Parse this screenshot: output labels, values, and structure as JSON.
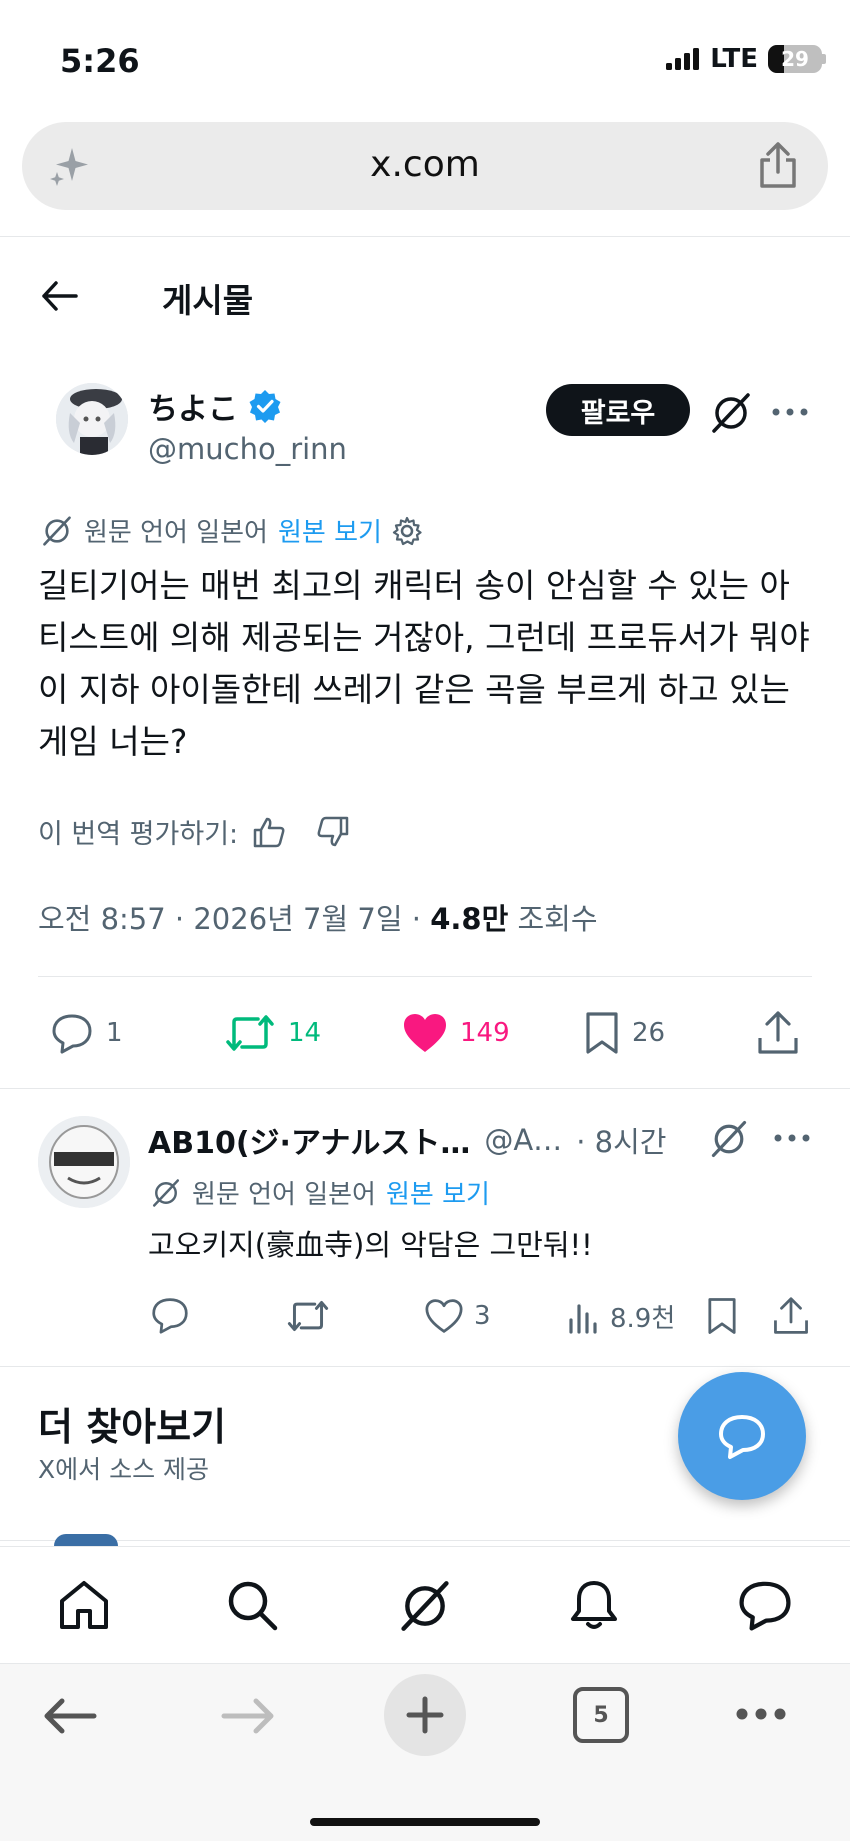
{
  "status_bar": {
    "time": "5:26",
    "network": "LTE",
    "battery": "29",
    "battery_level": 0.29
  },
  "browser": {
    "url": "x.com",
    "tab_count": "5"
  },
  "header": {
    "title": "게시물"
  },
  "tweet": {
    "name": "ちよこ",
    "handle": "@mucho_rinn",
    "follow_label": "팔로우",
    "translated_from": "원문 언어 일본어",
    "view_original": "원본 보기",
    "text": "길티기어는 매번 최고의 캐릭터 송이 안심할 수 있는 아티스트에 의해 제공되는 거잖아, 그런데 프로듀서가 뭐야 이 지하 아이돌한테 쓰레기 같은 곡을 부르게 하고 있는 게임 너는?",
    "rate_translation": "이 번역 평가하기:",
    "time": "오전 8:57",
    "date": "2026년 7월 7일",
    "views_count": "4.8만",
    "views_label": "조회수",
    "replies": "1",
    "reposts": "14",
    "likes": "149",
    "bookmarks": "26"
  },
  "reply": {
    "name": "AB10(ジ·アナルスト…",
    "handle": "@A…",
    "time": "· 8시간",
    "translated_from": "원문 언어 일본어",
    "view_original": "원본 보기",
    "text": "고오키지(豪血寺)의 악담은 그만둬!!",
    "likes": "3",
    "views": "8.9천"
  },
  "explore": {
    "title": "더 찾아보기",
    "subtitle": "X에서 소스 제공"
  },
  "colors": {
    "link": "#1d9bf0",
    "repost": "#00ba7c",
    "like": "#f91880",
    "fab": "#4a9de6"
  },
  "icons": [
    "sparkle-icon",
    "share-icon",
    "back-arrow-icon",
    "verified-badge-icon",
    "grok-icon",
    "more-icon",
    "gear-icon",
    "thumbs-up-icon",
    "thumbs-down-icon",
    "reply-icon",
    "repost-icon",
    "heart-icon",
    "bookmark-icon",
    "views-icon",
    "home-icon",
    "search-icon",
    "bell-icon",
    "chat-icon",
    "plus-icon"
  ]
}
